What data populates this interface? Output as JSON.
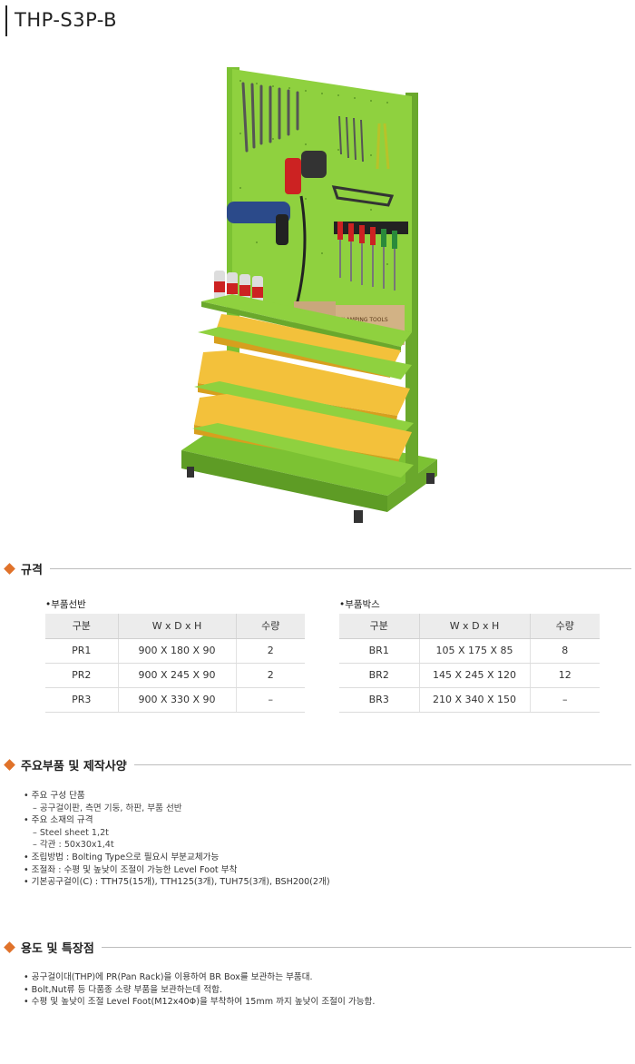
{
  "title": "THP-S3P-B",
  "sections": {
    "spec": "규격",
    "parts": "주요부품 및 제작사양",
    "usage": "용도 및 특장점"
  },
  "shelf_table": {
    "caption": "•부품선반",
    "headers": [
      "구분",
      "W x D x H",
      "수량"
    ],
    "rows": [
      [
        "PR1",
        "900 X 180 X 90",
        "2"
      ],
      [
        "PR2",
        "900 X 245 X 90",
        "2"
      ],
      [
        "PR3",
        "900 X 330 X 90",
        "–"
      ]
    ]
  },
  "box_table": {
    "caption": "•부품박스",
    "headers": [
      "구분",
      "W x D x H",
      "수량"
    ],
    "rows": [
      [
        "BR1",
        "105 X 175 X 85",
        "8"
      ],
      [
        "BR2",
        "145 X 245 X 120",
        "12"
      ],
      [
        "BR3",
        "210 X 340 X 150",
        "–"
      ]
    ]
  },
  "parts_list": [
    {
      "kind": "b",
      "text": "주요 구성 단품"
    },
    {
      "kind": "s",
      "text": "– 공구걸이판, 측면 기둥, 하판, 부품 선반"
    },
    {
      "kind": "b",
      "text": "주요 소재의 규격"
    },
    {
      "kind": "s",
      "text": "– Steel sheet 1,2t"
    },
    {
      "kind": "s",
      "text": "– 각관 : 50x30x1,4t"
    },
    {
      "kind": "b",
      "text": "조립방법 : Bolting Type으로 필요시 부분교체가능"
    },
    {
      "kind": "b",
      "text": "조절좌 : 수평 및 높낮이 조절이 가능한 Level Foot 부착"
    },
    {
      "kind": "b",
      "text": "기본공구걸이(C) : TTH75(15개), TTH125(3개), TUH75(3개), BSH200(2개)"
    }
  ],
  "usage_list": [
    "공구걸이대(THP)에 PR(Pan Rack)을 이용하여 BR Box를 보관하는 부품대.",
    "Bolt,Nut류 등 다품종 소량 부품을 보관하는데 적합.",
    "수평 및 높낮이 조절 Level Foot(M12x40Φ)을 부착하여 15mm 까지 높낮이 조절이 가능함."
  ],
  "figure": {
    "box_labels": [
      "CLAMPING TOOLS"
    ],
    "colors": {
      "frame": "#8fd13f",
      "frame_dark": "#6aa82c",
      "bin": "#f3c13b",
      "bin_dark": "#d79f1e",
      "box": "#c9a77c"
    }
  }
}
